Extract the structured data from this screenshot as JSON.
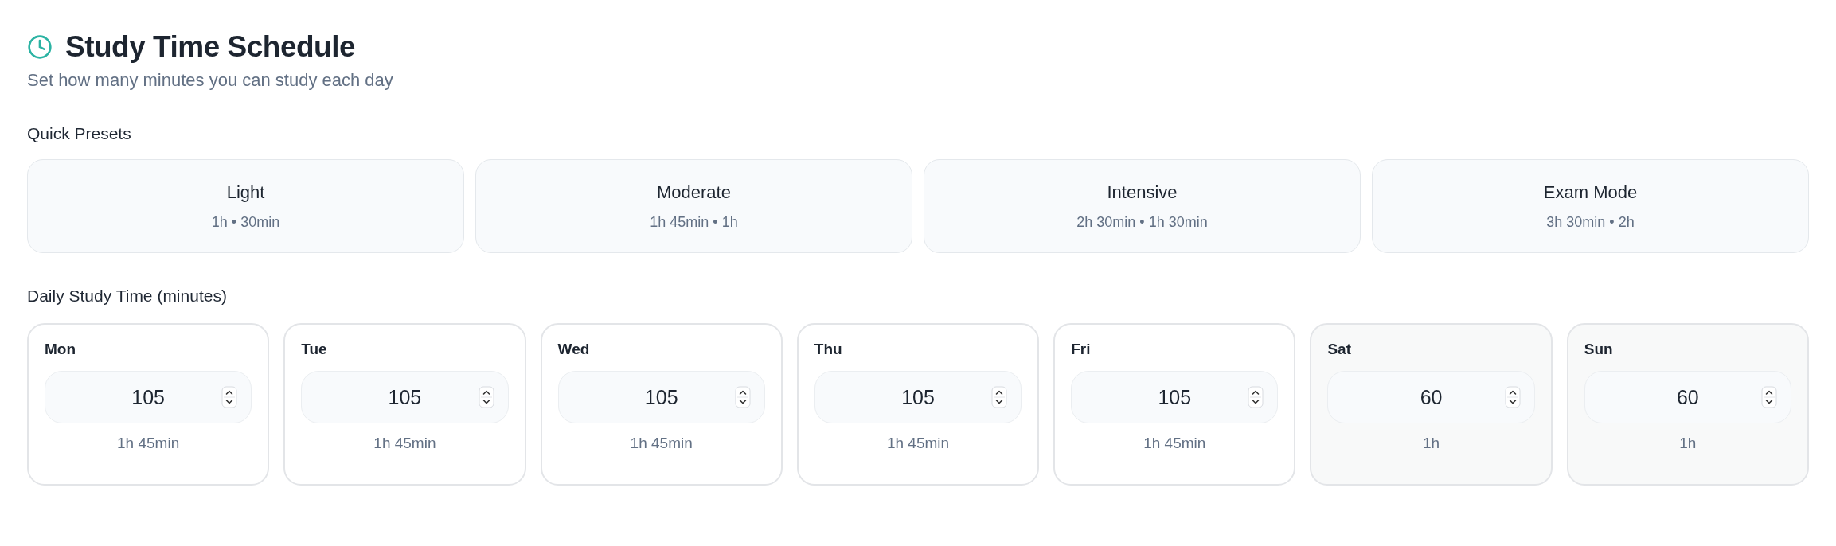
{
  "header": {
    "title": "Study Time Schedule",
    "subtitle": "Set how many minutes you can study each day"
  },
  "presets": {
    "label": "Quick Presets",
    "items": [
      {
        "name": "Light",
        "detail": "1h • 30min"
      },
      {
        "name": "Moderate",
        "detail": "1h 45min • 1h"
      },
      {
        "name": "Intensive",
        "detail": "2h 30min • 1h 30min"
      },
      {
        "name": "Exam Mode",
        "detail": "3h 30min • 2h"
      }
    ]
  },
  "daily": {
    "label": "Daily Study Time (minutes)",
    "days": [
      {
        "day": "Mon",
        "value": "105",
        "duration": "1h 45min",
        "kind": "weekday"
      },
      {
        "day": "Tue",
        "value": "105",
        "duration": "1h 45min",
        "kind": "weekday"
      },
      {
        "day": "Wed",
        "value": "105",
        "duration": "1h 45min",
        "kind": "weekday"
      },
      {
        "day": "Thu",
        "value": "105",
        "duration": "1h 45min",
        "kind": "weekday"
      },
      {
        "day": "Fri",
        "value": "105",
        "duration": "1h 45min",
        "kind": "weekday"
      },
      {
        "day": "Sat",
        "value": "60",
        "duration": "1h",
        "kind": "weekend"
      },
      {
        "day": "Sun",
        "value": "60",
        "duration": "1h",
        "kind": "weekend"
      }
    ]
  }
}
